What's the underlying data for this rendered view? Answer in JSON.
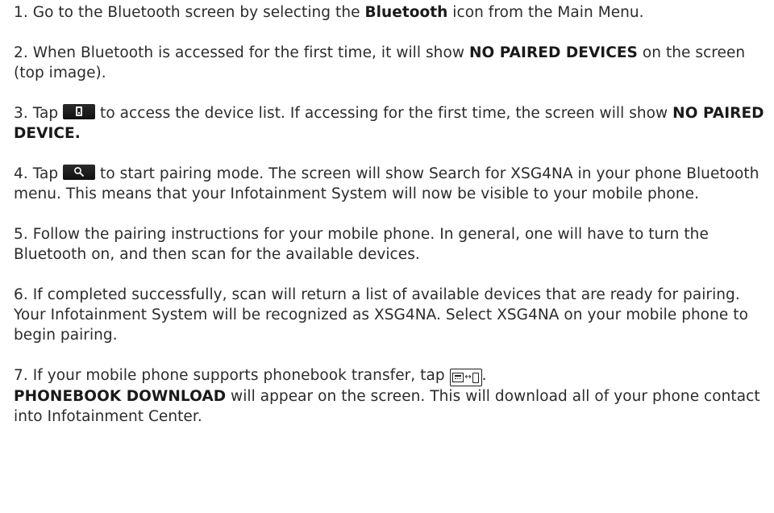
{
  "steps": [
    {
      "num": "1.",
      "text_a": " Go to the Bluetooth screen by selecting the ",
      "bold_a": "Bluetooth",
      "text_b": " icon from the Main Menu."
    },
    {
      "num": "2.",
      "text_a": " When Bluetooth is accessed for the first time, it will show ",
      "bold_a": "NO PAIRED DEVICES",
      "text_b": " on the screen (top image)."
    },
    {
      "num": "3.",
      "text_a": " Tap ",
      "icon": "phone-icon",
      "text_b": " to access the device list. If accessing for the first time, the screen will show ",
      "bold_a": "NO PAIRED DEVICE."
    },
    {
      "num": "4.",
      "text_a": " Tap ",
      "icon": "search-icon",
      "text_b": " to start pairing mode. The screen will show Search for XSG4NA in your phone Bluetooth menu. This means that your Infotainment System will now be visible to your mobile phone."
    },
    {
      "num": "5.",
      "text_a": " Follow the pairing instructions for your mobile phone. In general, one will have to turn the Bluetooth on, and then scan for the available devices."
    },
    {
      "num": "6.",
      "text_a": " If completed successfully, scan will return a list of available devices that are ready for pairing. Your Infotainment System will be recognized as XSG4NA. Select XSG4NA on your mobile phone to begin pairing."
    },
    {
      "num": "7.",
      "text_a": " If your mobile phone supports phonebook transfer, tap ",
      "icon": "phonebook-transfer-icon",
      "text_b": ".",
      "bold_a": "PHONEBOOK DOWNLOAD",
      "text_c": " will appear on the screen. This will download all of your phone contact into Infotainment Center."
    }
  ]
}
